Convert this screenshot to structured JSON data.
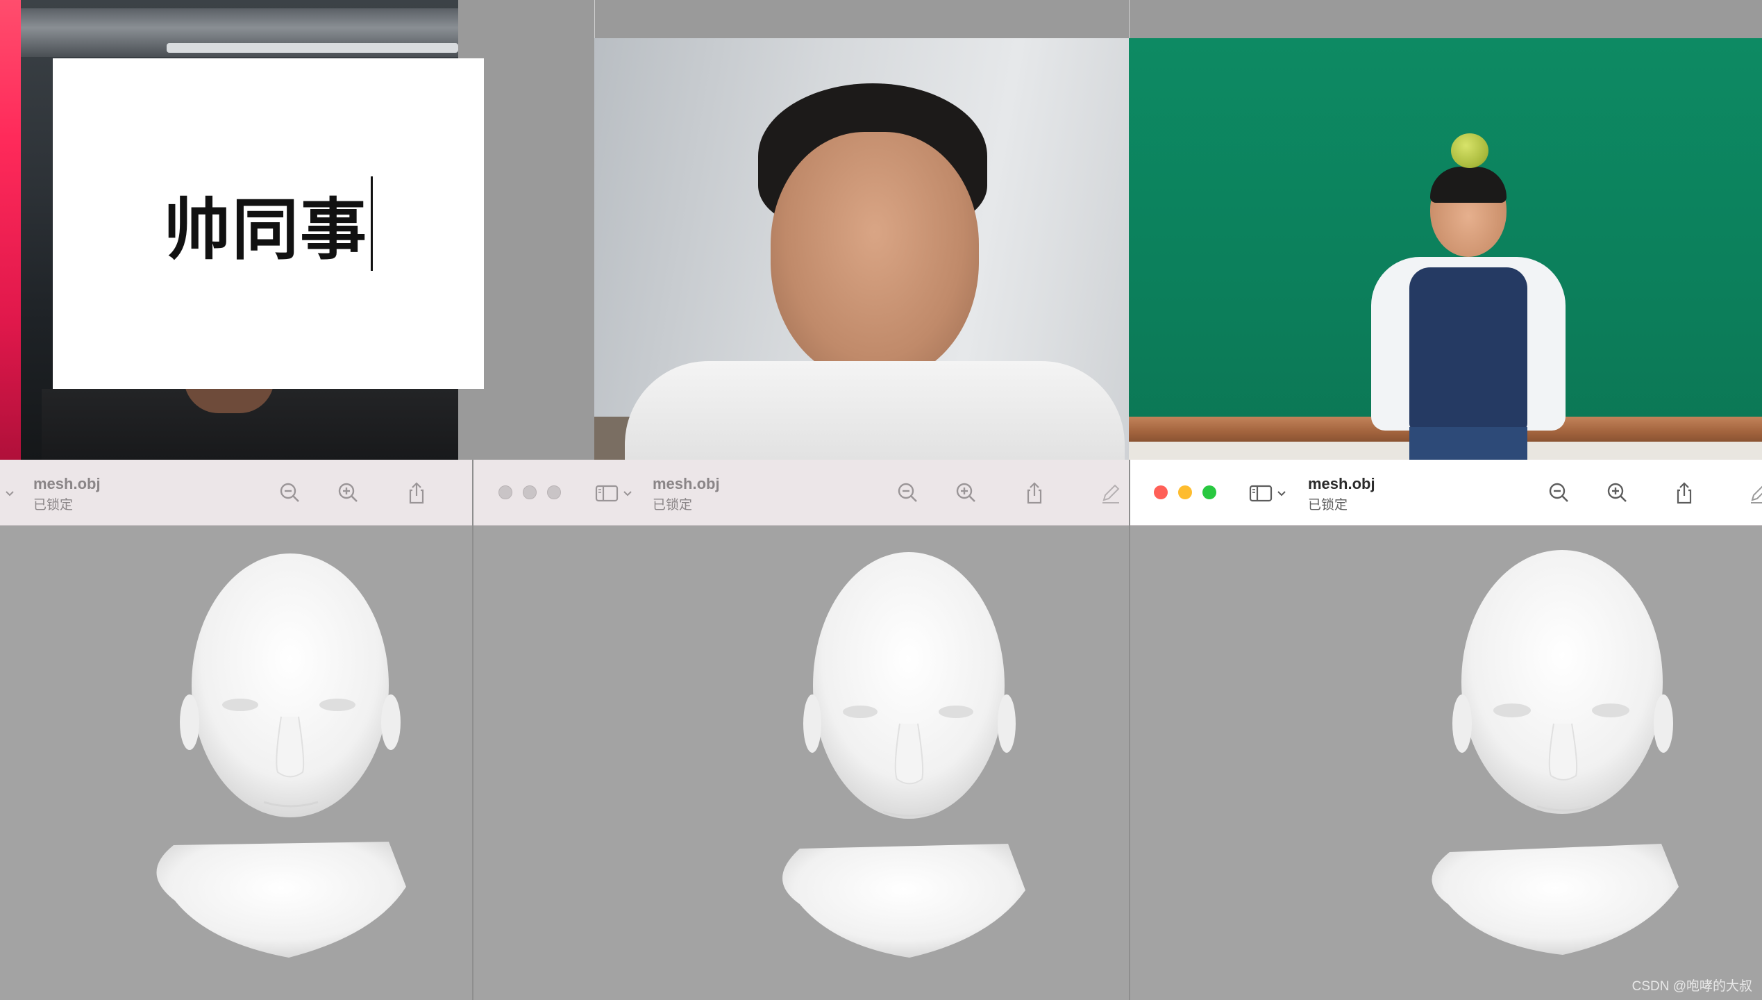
{
  "overlay_note": {
    "text": "帅同事"
  },
  "windows": [
    {
      "title": "mesh.obj",
      "subtitle": "已锁定",
      "focused": false,
      "toolbar": [
        "sidebar-toggle",
        "zoom-out",
        "zoom-in",
        "share"
      ]
    },
    {
      "title": "mesh.obj",
      "subtitle": "已锁定",
      "focused": false,
      "traffic_lights": [
        "close",
        "minimize",
        "zoom"
      ],
      "toolbar": [
        "sidebar-toggle",
        "zoom-out",
        "zoom-in",
        "share",
        "markup"
      ]
    },
    {
      "title": "mesh.obj",
      "subtitle": "已锁定",
      "focused": true,
      "traffic_lights": [
        "close",
        "minimize",
        "zoom"
      ],
      "toolbar": [
        "sidebar-toggle",
        "zoom-out",
        "zoom-in",
        "share",
        "markup"
      ]
    }
  ],
  "icons": {
    "zoom_out": "zoom-out-icon",
    "zoom_in": "zoom-in-icon",
    "share": "share-icon",
    "sidebar": "sidebar-icon",
    "markup": "pencil-icon",
    "chevron": "chevron-down-icon"
  },
  "colors": {
    "close": "#ff5f57",
    "minimize": "#febc2e",
    "zoom": "#28c840",
    "inactive_light": "#c9c4c6",
    "pane_bg": "#a3a3a3"
  },
  "watermark": "CSDN @咆哮的大叔"
}
